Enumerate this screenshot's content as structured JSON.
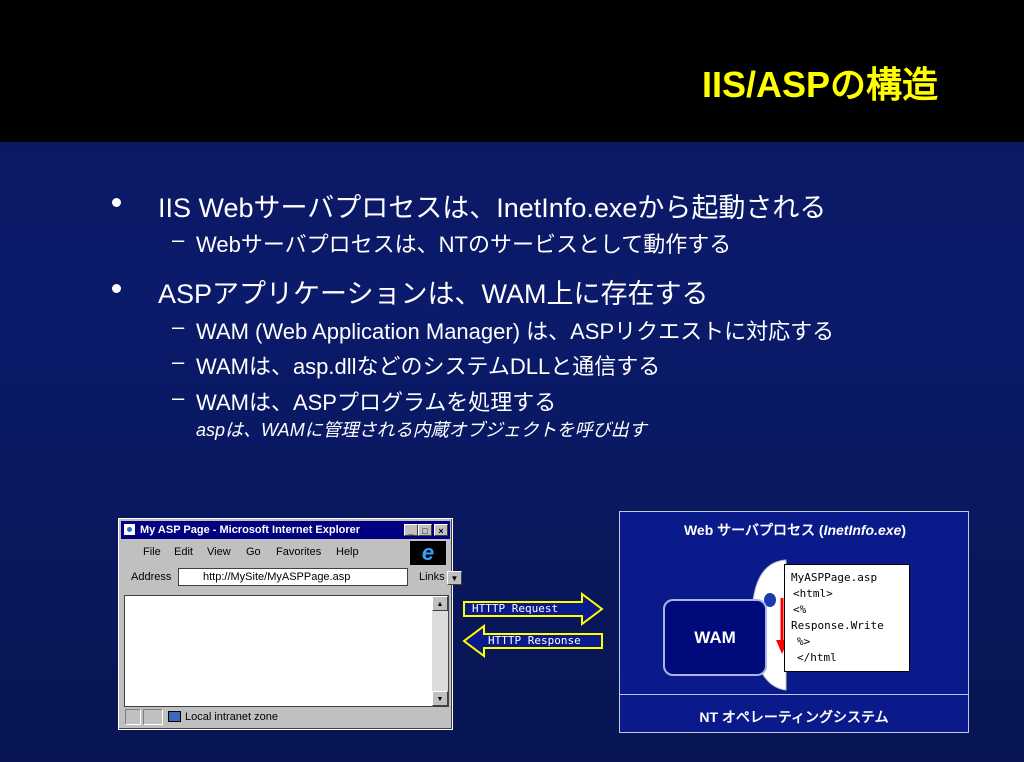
{
  "title": "IIS/ASPの構造",
  "bullets": [
    {
      "text": "IIS Webサーバプロセスは、InetInfo.exeから起動される",
      "subs": [
        {
          "text": "Webサーバプロセスは、NTのサービスとして動作する"
        }
      ]
    },
    {
      "text": "ASPアプリケーションは、WAM上に存在する",
      "subs": [
        {
          "text": "WAM (Web Application Manager) は、ASPリクエストに対応する"
        },
        {
          "text": "WAMは、asp.dllなどのシステムDLLと通信する"
        },
        {
          "text": "WAMは、ASPプログラムを処理する",
          "note": "aspは、WAMに管理される内蔵オブジェクトを呼び出す"
        }
      ]
    }
  ],
  "dash": "–",
  "browser": {
    "title": "My ASP Page - Microsoft Internet Explorer",
    "menu": [
      "File",
      "Edit",
      "View",
      "Go",
      "Favorites",
      "Help"
    ],
    "address_label": "Address",
    "address_value": "http://MySite/MyASPPage.asp",
    "links_label": "Links",
    "status": "Local intranet zone",
    "minimize": "_",
    "maximize": "□",
    "close": "×",
    "logo": "e"
  },
  "arrows": {
    "request": "HTTTP Request",
    "response": "HTTTP Response"
  },
  "server": {
    "header_prefix": "Web サーバプロセス (",
    "header_exe": "InetInfo.exe",
    "header_suffix": ")",
    "wam_label": "WAM",
    "code_lines": [
      "MyASPPage.asp",
      " <html>",
      " <%",
      " Response.Write",
      "  %>",
      "  </html"
    ],
    "os_label": "NT オペレーティングシステム"
  },
  "colors": {
    "title": "#ffff00",
    "background": "#0b1a6a",
    "arrow_fill": "#0a1a8a",
    "arrow_stroke": "#ffff00",
    "red_arrow": "#ff0000"
  }
}
